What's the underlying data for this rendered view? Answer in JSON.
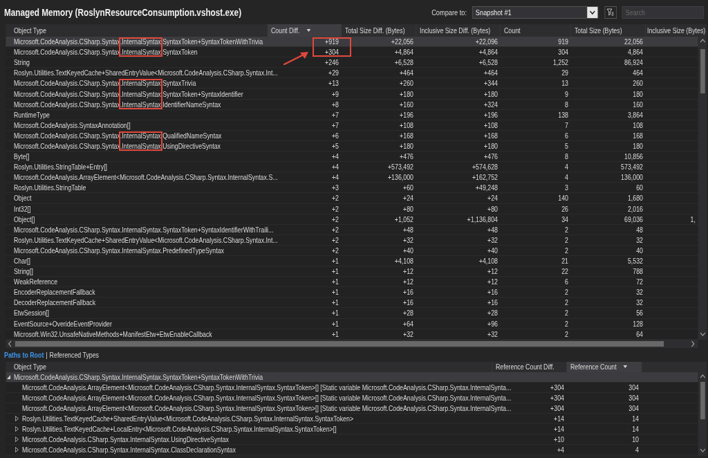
{
  "title": "Managed Memory (RoslynResourceConsumption.vshost.exe)",
  "compare": {
    "label": "Compare to:",
    "value": "Snapshot #1"
  },
  "search": {
    "placeholder": "Search"
  },
  "table": {
    "columns": [
      {
        "label": "Object Type",
        "sorted": false
      },
      {
        "label": "Count Diff.",
        "sorted": true
      },
      {
        "label": "Total Size Diff. (Bytes)",
        "sorted": false
      },
      {
        "label": "Inclusive Size Diff. (Bytes)",
        "sorted": false
      },
      {
        "label": "Count",
        "sorted": false
      },
      {
        "label": "Total Size (Bytes)",
        "sorted": false
      },
      {
        "label": "Inclusive Size (Bytes)",
        "sorted": false
      }
    ],
    "rows": [
      {
        "selected": true,
        "cells": [
          "Microsoft.CodeAnalysis.CSharp.Syntax.InternalSyntax.SyntaxToken+SyntaxTokenWithTrivia",
          "+919",
          "+22,056",
          "+22,096",
          "919",
          "22,056"
        ]
      },
      {
        "selected": false,
        "cells": [
          "Microsoft.CodeAnalysis.CSharp.Syntax.InternalSyntax.SyntaxToken",
          "+304",
          "+4,864",
          "+4,864",
          "304",
          "4,864"
        ]
      },
      {
        "selected": false,
        "cells": [
          "String",
          "+246",
          "+6,528",
          "+6,528",
          "1,252",
          "86,924"
        ]
      },
      {
        "selected": false,
        "cells": [
          "Roslyn.Utilities.TextKeyedCache+SharedEntryValue<Microsoft.CodeAnalysis.CSharp.Syntax.Int...",
          "+29",
          "+464",
          "+464",
          "29",
          "464"
        ]
      },
      {
        "selected": false,
        "cells": [
          "Microsoft.CodeAnalysis.CSharp.Syntax.InternalSyntax.SyntaxTrivia",
          "+13",
          "+260",
          "+344",
          "13",
          "260"
        ]
      },
      {
        "selected": false,
        "cells": [
          "Microsoft.CodeAnalysis.CSharp.Syntax.InternalSyntax.SyntaxToken+SyntaxIdentifier",
          "+9",
          "+180",
          "+180",
          "9",
          "180"
        ]
      },
      {
        "selected": false,
        "cells": [
          "Microsoft.CodeAnalysis.CSharp.Syntax.InternalSyntax.IdentifierNameSyntax",
          "+8",
          "+160",
          "+324",
          "8",
          "160"
        ]
      },
      {
        "selected": false,
        "cells": [
          "RuntimeType",
          "+7",
          "+196",
          "+196",
          "138",
          "3,864"
        ]
      },
      {
        "selected": false,
        "cells": [
          "Microsoft.CodeAnalysis.SyntaxAnnotation[]",
          "+7",
          "+108",
          "+108",
          "7",
          "108"
        ]
      },
      {
        "selected": false,
        "cells": [
          "Microsoft.CodeAnalysis.CSharp.Syntax.InternalSyntax.QualifiedNameSyntax",
          "+6",
          "+168",
          "+168",
          "6",
          "168"
        ]
      },
      {
        "selected": false,
        "cells": [
          "Microsoft.CodeAnalysis.CSharp.Syntax.InternalSyntax.UsingDirectiveSyntax",
          "+5",
          "+180",
          "+180",
          "5",
          "180"
        ]
      },
      {
        "selected": false,
        "cells": [
          "Byte[]",
          "+4",
          "+476",
          "+476",
          "8",
          "10,856"
        ]
      },
      {
        "selected": false,
        "cells": [
          "Roslyn.Utilities.StringTable+Entry[]",
          "+4",
          "+573,492",
          "+574,628",
          "4",
          "573,492"
        ]
      },
      {
        "selected": false,
        "cells": [
          "Microsoft.CodeAnalysis.ArrayElement<Microsoft.CodeAnalysis.CSharp.Syntax.InternalSyntax.S...",
          "+4",
          "+136,000",
          "+162,752",
          "4",
          "136,000"
        ]
      },
      {
        "selected": false,
        "cells": [
          "Roslyn.Utilities.StringTable",
          "+3",
          "+60",
          "+49,248",
          "3",
          "60"
        ]
      },
      {
        "selected": false,
        "cells": [
          "Object",
          "+2",
          "+24",
          "+24",
          "140",
          "1,680"
        ]
      },
      {
        "selected": false,
        "cells": [
          "Int32[]",
          "+2",
          "+80",
          "+80",
          "26",
          "2,016"
        ]
      },
      {
        "selected": false,
        "cells": [
          "Object[]",
          "+2",
          "+1,052",
          "+1,136,804",
          "34",
          "69,036",
          "1,"
        ]
      },
      {
        "selected": false,
        "cells": [
          "Microsoft.CodeAnalysis.CSharp.Syntax.InternalSyntax.SyntaxToken+SyntaxIdentifierWithTraili...",
          "+2",
          "+48",
          "+48",
          "2",
          "48"
        ]
      },
      {
        "selected": false,
        "cells": [
          "Roslyn.Utilities.TextKeyedCache+SharedEntryValue<Microsoft.CodeAnalysis.CSharp.Syntax.Int...",
          "+2",
          "+32",
          "+32",
          "2",
          "32"
        ]
      },
      {
        "selected": false,
        "cells": [
          "Microsoft.CodeAnalysis.CSharp.Syntax.InternalSyntax.PredefinedTypeSyntax",
          "+2",
          "+40",
          "+40",
          "2",
          "40"
        ]
      },
      {
        "selected": false,
        "cells": [
          "Char[]",
          "+1",
          "+4,108",
          "+4,108",
          "21",
          "5,532"
        ]
      },
      {
        "selected": false,
        "cells": [
          "String[]",
          "+1",
          "+12",
          "+12",
          "22",
          "788"
        ]
      },
      {
        "selected": false,
        "cells": [
          "WeakReference",
          "+1",
          "+12",
          "+12",
          "6",
          "72"
        ]
      },
      {
        "selected": false,
        "cells": [
          "EncoderReplacementFallback",
          "+1",
          "+16",
          "+16",
          "2",
          "32"
        ]
      },
      {
        "selected": false,
        "cells": [
          "DecoderReplacementFallback",
          "+1",
          "+16",
          "+16",
          "2",
          "32"
        ]
      },
      {
        "selected": false,
        "cells": [
          "EtwSession[]",
          "+1",
          "+28",
          "+28",
          "2",
          "56"
        ]
      },
      {
        "selected": false,
        "cells": [
          "EventSource+OverideEventProvider",
          "+1",
          "+64",
          "+96",
          "2",
          "128"
        ]
      },
      {
        "selected": false,
        "cells": [
          "Microsoft.Win32.UnsafeNativeMethods+ManifestEtw+EtwEnableCallback",
          "+1",
          "+32",
          "+32",
          "2",
          "64"
        ]
      }
    ]
  },
  "annotations": [
    {
      "kind": "box"
    },
    {
      "kind": "box"
    },
    {
      "kind": "box"
    },
    {
      "kind": "box"
    },
    {
      "kind": "arrow"
    }
  ],
  "tabs": [
    {
      "label": "Paths to Root",
      "selected": true
    },
    {
      "label": "Referenced Types",
      "selected": false
    }
  ],
  "tab_separator": "|",
  "tree": {
    "columns": [
      {
        "label": "Object Type",
        "sorted": false
      },
      {
        "label": "Reference Count Diff.",
        "sorted": false
      },
      {
        "label": "Reference Count",
        "sorted": true
      }
    ],
    "rows": [
      {
        "selected": true,
        "expanded": true,
        "cells": [
          "Microsoft.CodeAnalysis.CSharp.Syntax.InternalSyntax.SyntaxToken+SyntaxTokenWithTrivia"
        ],
        "children": [
          {
            "selected": false,
            "cells": [
              "Microsoft.CodeAnalysis.ArrayElement<Microsoft.CodeAnalysis.CSharp.Syntax.InternalSyntax.SyntaxToken>[] [Static variable Microsoft.CodeAnalysis.CSharp.Syntax.InternalSynta...",
              "+304",
              "304"
            ]
          },
          {
            "selected": false,
            "cells": [
              "Microsoft.CodeAnalysis.ArrayElement<Microsoft.CodeAnalysis.CSharp.Syntax.InternalSyntax.SyntaxToken>[] [Static variable Microsoft.CodeAnalysis.CSharp.Syntax.InternalSynta...",
              "+304",
              "304"
            ]
          },
          {
            "selected": false,
            "cells": [
              "Microsoft.CodeAnalysis.ArrayElement<Microsoft.CodeAnalysis.CSharp.Syntax.InternalSyntax.SyntaxToken>[] [Static variable Microsoft.CodeAnalysis.CSharp.Syntax.InternalSynta...",
              "+304",
              "304"
            ]
          },
          {
            "selected": false,
            "expanded": false,
            "cells": [
              "Roslyn.Utilities.TextKeyedCache+SharedEntryValue<Microsoft.CodeAnalysis.CSharp.Syntax.InternalSyntax.SyntaxToken>",
              "+14",
              "14"
            ]
          },
          {
            "selected": false,
            "expanded": false,
            "cells": [
              "Roslyn.Utilities.TextKeyedCache+LocalEntry<Microsoft.CodeAnalysis.CSharp.Syntax.InternalSyntax.SyntaxToken>[]",
              "+14",
              "14"
            ]
          },
          {
            "selected": false,
            "expanded": false,
            "cells": [
              "Microsoft.CodeAnalysis.CSharp.Syntax.InternalSyntax.UsingDirectiveSyntax",
              "+10",
              "10"
            ]
          },
          {
            "selected": false,
            "expanded": false,
            "cells": [
              "Microsoft.CodeAnalysis.CSharp.Syntax.InternalSyntax.ClassDeclarationSyntax",
              "+4",
              "4"
            ]
          }
        ]
      }
    ]
  }
}
